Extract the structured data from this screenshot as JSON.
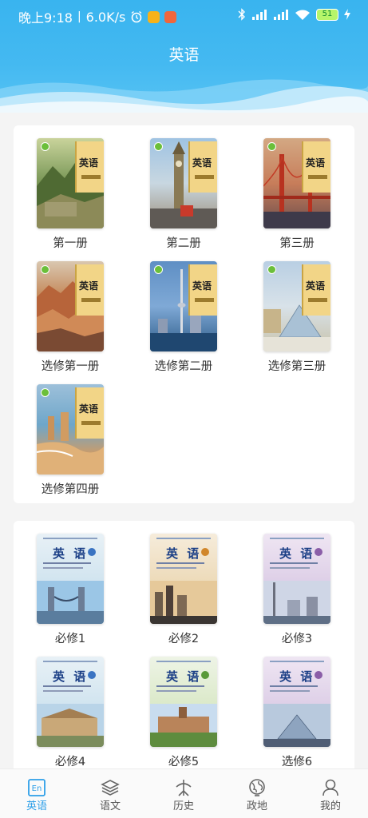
{
  "status_bar": {
    "time": "晚上9:18",
    "speed": "6.0K/s",
    "battery": "51"
  },
  "header": {
    "title": "英语"
  },
  "section1": {
    "books": [
      {
        "label": "第一册"
      },
      {
        "label": "第二册"
      },
      {
        "label": "第三册"
      },
      {
        "label": "选修第一册"
      },
      {
        "label": "选修第二册"
      },
      {
        "label": "选修第三册"
      },
      {
        "label": "选修第四册"
      }
    ]
  },
  "section2": {
    "books": [
      {
        "label": "必修1"
      },
      {
        "label": "必修2"
      },
      {
        "label": "必修3"
      },
      {
        "label": "必修4"
      },
      {
        "label": "必修5"
      },
      {
        "label": "选修6"
      }
    ]
  },
  "covers": {
    "title_text": "英语",
    "new_title_text": "英 语"
  },
  "tabbar": {
    "tabs": [
      {
        "label": "英语",
        "icon": "en-icon",
        "active": true
      },
      {
        "label": "语文",
        "icon": "layers-icon",
        "active": false
      },
      {
        "label": "历史",
        "icon": "history-icon",
        "active": false
      },
      {
        "label": "政地",
        "icon": "globe-icon",
        "active": false
      },
      {
        "label": "我的",
        "icon": "user-icon",
        "active": false
      }
    ]
  },
  "colors": {
    "header": "#3fb6f0",
    "accent": "#2d9fe8",
    "text": "#333333",
    "background": "#f4f4f4"
  }
}
